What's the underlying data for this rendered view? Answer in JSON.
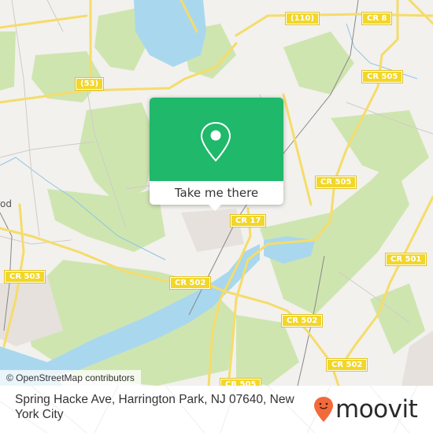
{
  "map": {
    "road_shields": [
      {
        "label": "(110)"
      },
      {
        "label": "CR 8"
      },
      {
        "label": "(53)"
      },
      {
        "label": "CR 505"
      },
      {
        "label": "CR 505"
      },
      {
        "label": "CR 17"
      },
      {
        "label": "CR 501"
      },
      {
        "label": "CR 503"
      },
      {
        "label": "CR 502"
      },
      {
        "label": "CR 502"
      },
      {
        "label": "CR 502"
      },
      {
        "label": "CR 505"
      }
    ],
    "place_labels": [
      {
        "label": "od"
      }
    ],
    "attribution": "© OpenStreetMap contributors"
  },
  "popup": {
    "icon": "location-pin-icon",
    "button_label": "Take me there",
    "color": "#20b86a"
  },
  "footer": {
    "address": "Spring Hacke Ave, Harrington Park, NJ 07640, New York City",
    "brand": "moovit",
    "brand_color": "#f26a3b"
  }
}
